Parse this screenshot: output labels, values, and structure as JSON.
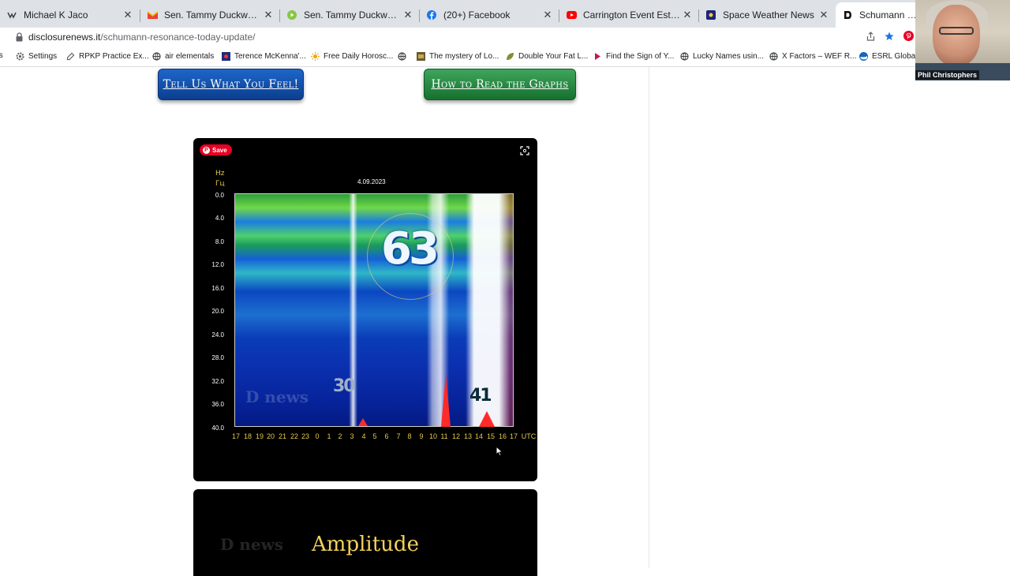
{
  "browser": {
    "tabs": [
      {
        "title": "Michael K Jaco",
        "icon": "video-icon"
      },
      {
        "title": "Sen. Tammy Duckworth (D-IL)",
        "icon": "gmail-icon"
      },
      {
        "title": "Sen. Tammy Duckworth (D-IL)",
        "icon": "rumble-icon"
      },
      {
        "title": "(20+) Facebook",
        "icon": "facebook-icon"
      },
      {
        "title": "Carrington Event Estimate & R",
        "icon": "youtube-icon"
      },
      {
        "title": "Space Weather News",
        "icon": "site-icon"
      },
      {
        "title": "Schumann Resona",
        "icon": "site-icon"
      }
    ],
    "close_glyph": "✕",
    "url_domain": "disclosurenews.it",
    "url_path": "/schumann-resonance-today-update/"
  },
  "bookmarks": [
    {
      "label": "Settings",
      "icon": "gear-icon"
    },
    {
      "label": "RPKP Practice Ex...",
      "icon": "link-icon"
    },
    {
      "label": "air elementals",
      "icon": "globe-icon"
    },
    {
      "label": "Terence McKenna'...",
      "icon": "site-icon"
    },
    {
      "label": "Free Daily Horosc...",
      "icon": "sun-icon"
    },
    {
      "label": "",
      "icon": "globe-icon"
    },
    {
      "label": "The mystery of Lo...",
      "icon": "site-icon"
    },
    {
      "label": "Double Your Fat L...",
      "icon": "leaf-icon"
    },
    {
      "label": "Find the Sign of Y...",
      "icon": "site-icon"
    },
    {
      "label": "Lucky Names usin...",
      "icon": "globe-icon"
    },
    {
      "label": "X Factors – WEF R...",
      "icon": "globe-icon"
    },
    {
      "label": "ESRL Global",
      "icon": "noaa-icon"
    }
  ],
  "page": {
    "cta_feel": "Tell Us What You Feel!",
    "cta_graphs": "How to Read the Graphs",
    "save_label": "Save",
    "unit_hz": "Hz",
    "unit_gc": "Гц",
    "graph_date": "4.09.2023",
    "y_labels": [
      "0.0",
      "4.0",
      "8.0",
      "12.0",
      "16.0",
      "20.0",
      "24.0",
      "28.0",
      "32.0",
      "36.0",
      "40.0"
    ],
    "x_labels": [
      "17",
      "18",
      "19",
      "20",
      "21",
      "22",
      "23",
      "0",
      "1",
      "2",
      "3",
      "4",
      "5",
      "6",
      "7",
      "8",
      "9",
      "10",
      "11",
      "12",
      "13",
      "14",
      "15",
      "16",
      "17",
      "UTC"
    ],
    "peak_main": "63",
    "peak_left": "30",
    "peak_right": "41",
    "watermark": "D news",
    "amplitude_title": "Amplitude",
    "amplitude_watermark": "D news"
  },
  "webcam": {
    "name": "Phil Christophers"
  }
}
